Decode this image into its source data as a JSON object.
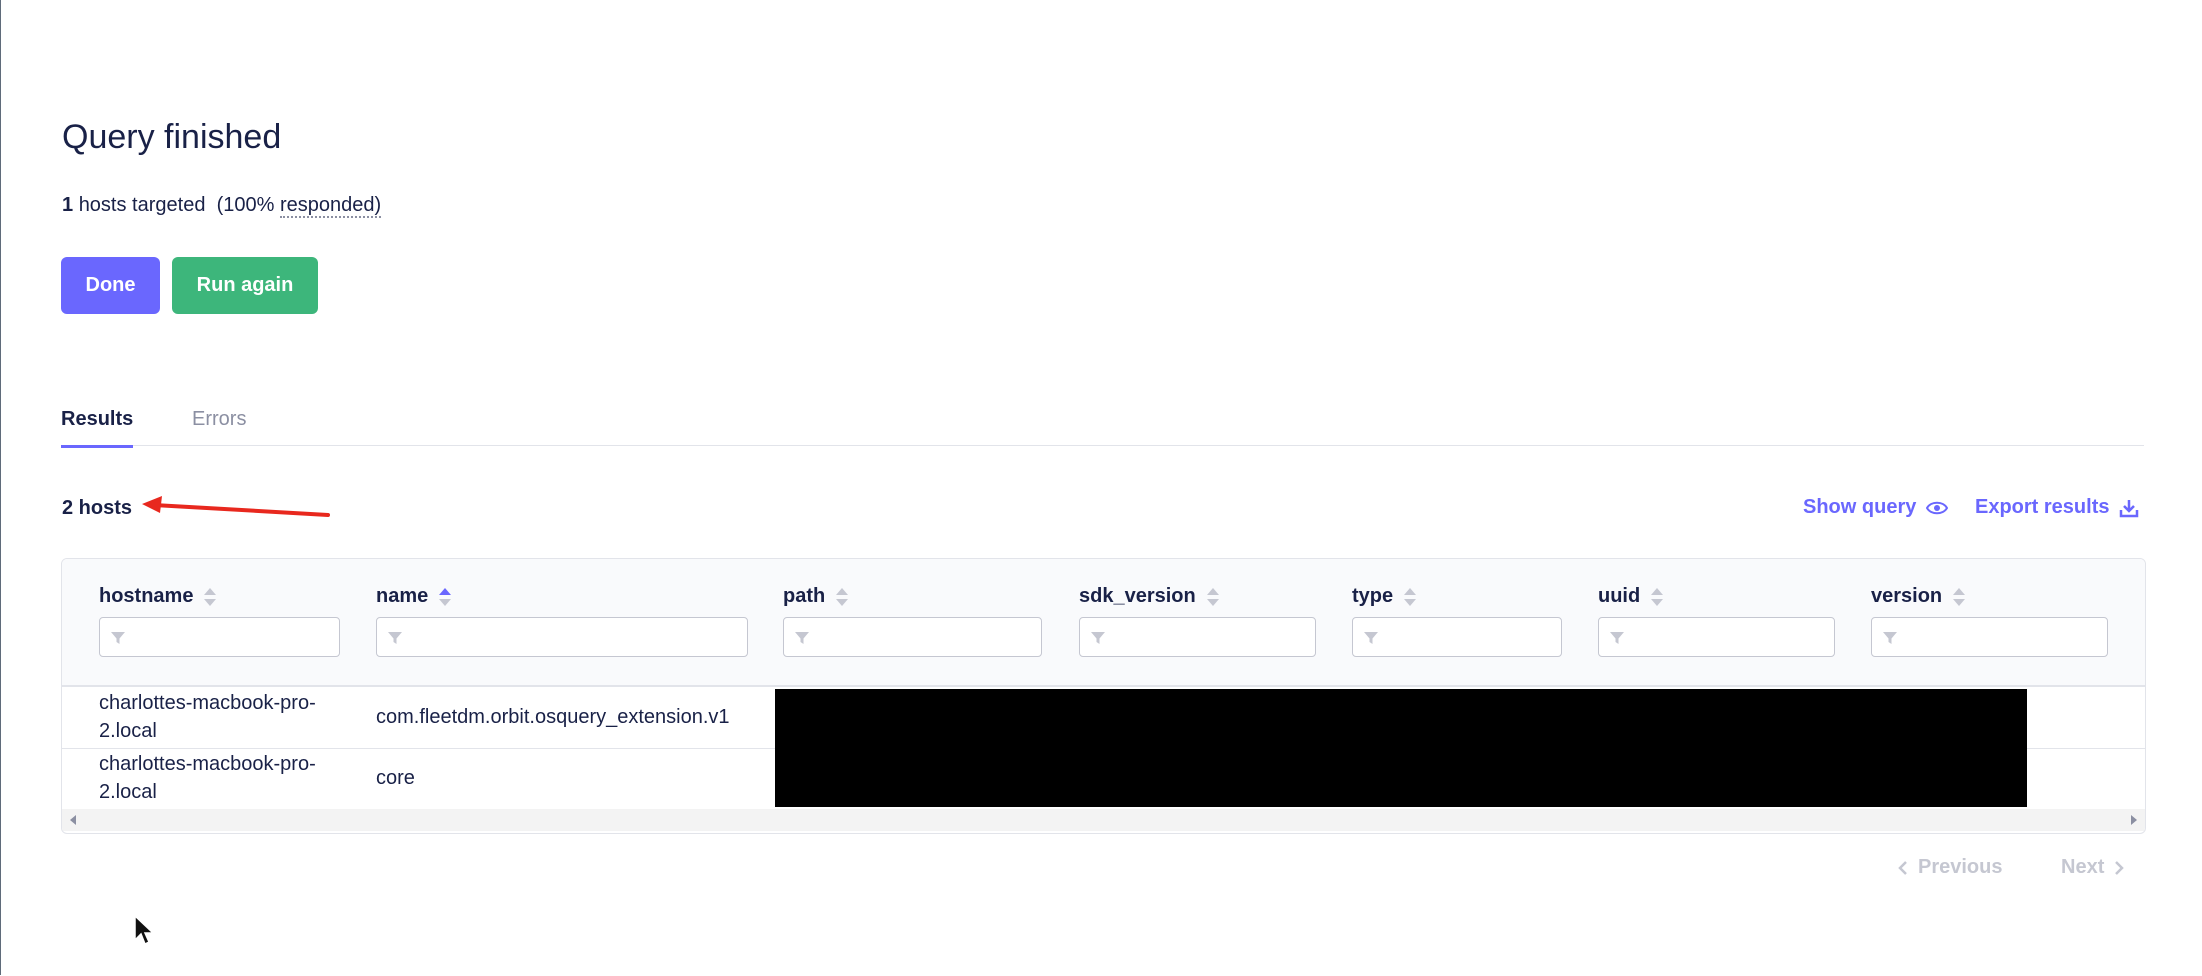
{
  "header": {
    "title": "Query finished",
    "targeted_count": "1",
    "targeted_text": "hosts targeted",
    "responded_pct": "(100%",
    "responded_word": "responded)"
  },
  "buttons": {
    "done": "Done",
    "run_again": "Run again"
  },
  "tabs": [
    {
      "label": "Results",
      "active": true
    },
    {
      "label": "Errors",
      "active": false
    }
  ],
  "results": {
    "host_count": "2 hosts",
    "show_query": "Show query",
    "export_results": "Export results"
  },
  "table": {
    "columns": [
      "hostname",
      "name",
      "path",
      "sdk_version",
      "type",
      "uuid",
      "version"
    ],
    "sorted_column": "name",
    "rows": [
      {
        "hostname": "charlottes-macbook-pro-2.local",
        "name": "com.fleetdm.orbit.osquery_extension.v1"
      },
      {
        "hostname": "charlottes-macbook-pro-2.local",
        "name": "core"
      }
    ]
  },
  "pagination": {
    "previous": "Previous",
    "next": "Next"
  },
  "colors": {
    "accent": "#6a67fe",
    "success": "#3db67b",
    "text": "#192147",
    "muted": "#8b8fa2",
    "annotation_arrow": "#e8281e"
  },
  "icons": [
    "eye-icon",
    "download-icon",
    "sort-icon",
    "filter-icon",
    "chevron-left-icon",
    "chevron-right-icon"
  ]
}
